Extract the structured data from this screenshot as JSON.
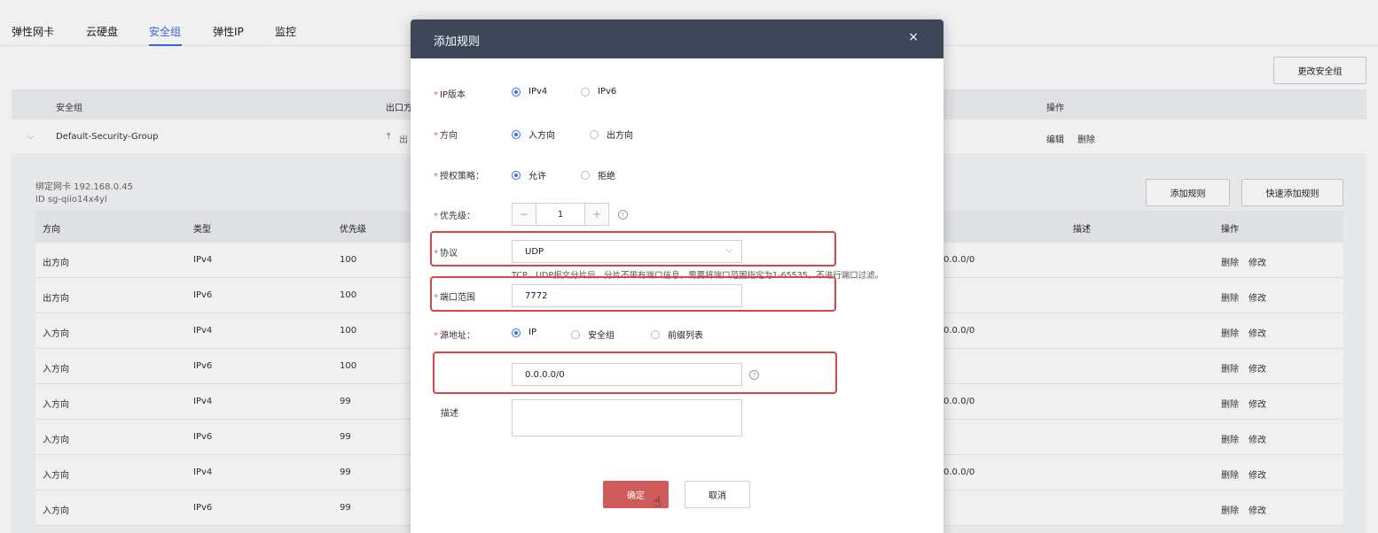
{
  "tabs": [
    "弹性网卡",
    "云硬盘",
    "安全组",
    "弹性IP",
    "监控"
  ],
  "active_tab": "安全组",
  "change_sg_button": "更改安全组",
  "sg_table": {
    "headers": [
      "安全组",
      "出口方",
      "操作"
    ],
    "row": {
      "name": "Default-Security-Group",
      "dir_partial": "出",
      "actions": [
        "编辑",
        "删除"
      ]
    }
  },
  "rules_panel": {
    "bind_nic": "绑定网卡 192.168.0.45",
    "id": "ID sg-qiio14x4yl",
    "add_rule_button": "添加规则",
    "quick_add_button": "快速添加规则",
    "headers": [
      "方向",
      "类型",
      "优先级",
      "描述",
      "操作"
    ],
    "rows": [
      {
        "dir": "出方向",
        "type": "IPv4",
        "priority": "100",
        "src": "0.0.0/0"
      },
      {
        "dir": "出方向",
        "type": "IPv6",
        "priority": "100",
        "src": ""
      },
      {
        "dir": "入方向",
        "type": "IPv4",
        "priority": "100",
        "src": "0.0.0/0"
      },
      {
        "dir": "入方向",
        "type": "IPv6",
        "priority": "100",
        "src": ""
      },
      {
        "dir": "入方向",
        "type": "IPv4",
        "priority": "99",
        "src": "0.0.0/0"
      },
      {
        "dir": "入方向",
        "type": "IPv6",
        "priority": "99",
        "src": ""
      },
      {
        "dir": "入方向",
        "type": "IPv4",
        "priority": "99",
        "src": "0.0.0/0"
      },
      {
        "dir": "入方向",
        "type": "IPv6",
        "priority": "99",
        "src": ""
      }
    ],
    "row_actions": [
      "删除",
      "修改"
    ]
  },
  "dialog": {
    "title": "添加规则",
    "close": "×",
    "ip_version": {
      "label": "IP版本",
      "options": [
        "IPv4",
        "IPv6"
      ],
      "selected": "IPv4"
    },
    "direction": {
      "label": "方向",
      "options": [
        "入方向",
        "出方向"
      ],
      "selected": "入方向"
    },
    "policy": {
      "label": "授权策略：",
      "options": [
        "允许",
        "拒绝"
      ],
      "selected": "允许"
    },
    "priority": {
      "label": "优先级：",
      "value": "1",
      "minus": "−",
      "plus": "+"
    },
    "protocol": {
      "label": "协议",
      "value": "UDP"
    },
    "hint": "TCP、UDP报文分片后，分片不带有端口信息，需要将端口范围指定为1-65535，不进行端口过滤。",
    "port_range": {
      "label": "端口范围",
      "value": "7772"
    },
    "source": {
      "label": "源地址：",
      "options": [
        "IP",
        "安全组",
        "前缀列表"
      ],
      "selected": "IP"
    },
    "source_ip": "0.0.0.0/0",
    "description": {
      "label": "描述"
    },
    "ok_button": "确定",
    "cancel_button": "取消"
  },
  "colors": {
    "accent": "#3a6ee8",
    "header": "#3c4658",
    "primary": "#cf5b5b",
    "highlight": "#d94444"
  }
}
